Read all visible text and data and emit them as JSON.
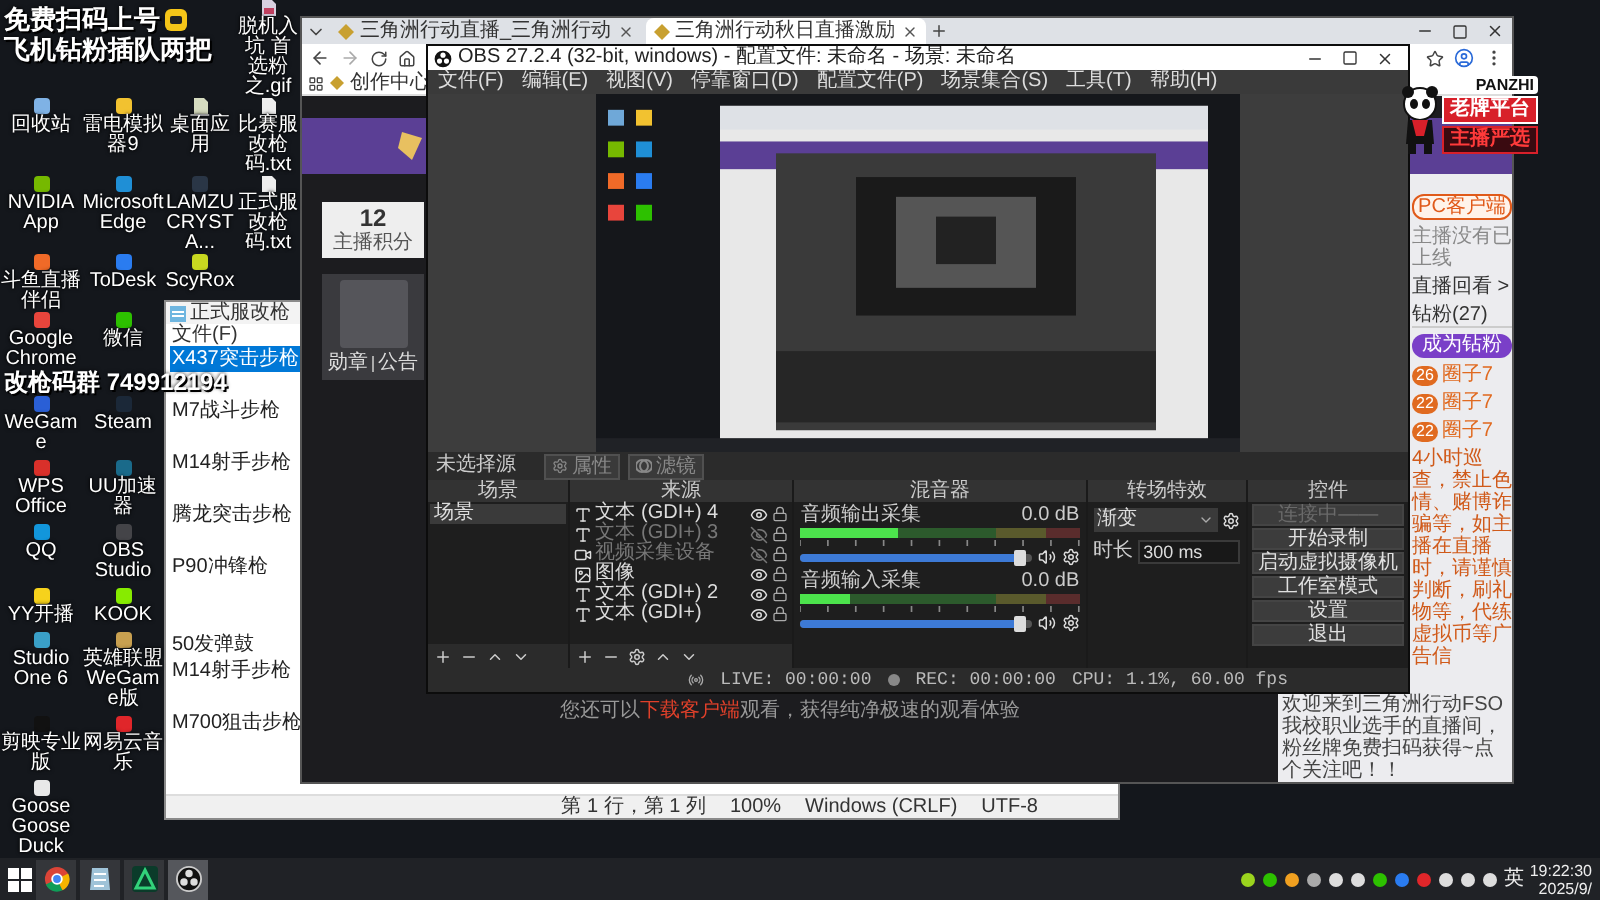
{
  "desktop": {
    "banner_lines": [
      "免费扫码上号",
      "飞机钻粉插队两把"
    ],
    "gif": {
      "label": "脱机入坑 首选粉之.gif",
      "kind": "image",
      "color": "#d8d0e0"
    },
    "icon_rows_top": [
      [
        {
          "label": "回收站",
          "kind": "app",
          "color": "#7fb2e5"
        },
        {
          "label": "雷电模拟器9",
          "kind": "app",
          "color": "#f2c230"
        },
        {
          "label": "桌面应用",
          "kind": "file",
          "color": "#d6dcc0"
        },
        {
          "label": "比赛服改枪码.txt",
          "kind": "file",
          "color": "#eeeeee"
        }
      ],
      [
        {
          "label": "NVIDIA App",
          "kind": "app",
          "color": "#76b900"
        },
        {
          "label": "Microsoft Edge",
          "kind": "app",
          "color": "#1f8fd6"
        },
        {
          "label": "LAMZU CRYSTA...",
          "kind": "app",
          "color": "#2a3646"
        },
        {
          "label": "正式服改枪码.txt",
          "kind": "file",
          "color": "#eeeeee"
        }
      ],
      [
        {
          "label": "斗鱼直播伴侣",
          "kind": "app",
          "color": "#f06a28"
        },
        {
          "label": "ToDesk",
          "kind": "app",
          "color": "#2a7cf0"
        },
        {
          "label": "ScyRox",
          "kind": "app",
          "color": "#c8d820"
        }
      ],
      [
        {
          "label": "Google Chrome",
          "kind": "app",
          "color": "#e8453c"
        },
        {
          "label": "微信",
          "kind": "app",
          "color": "#2dc100"
        }
      ]
    ],
    "overlay_text": "改枪码群 749912194",
    "icon_rows_bottom": [
      [
        {
          "label": "WeGame",
          "kind": "app",
          "color": "#2a5fd6"
        },
        {
          "label": "Steam",
          "kind": "app",
          "color": "#1b2838"
        }
      ],
      [
        {
          "label": "WPS Office",
          "kind": "app",
          "color": "#d9302a"
        },
        {
          "label": "UU加速器",
          "kind": "app",
          "color": "#1a6a8a"
        }
      ],
      [
        {
          "label": "QQ",
          "kind": "app",
          "color": "#1296db"
        },
        {
          "label": "OBS Studio",
          "kind": "app",
          "color": "#444448"
        }
      ],
      [
        {
          "label": "YY开播",
          "kind": "app",
          "color": "#f6d21c"
        },
        {
          "label": "KOOK",
          "kind": "app",
          "color": "#87eb00"
        }
      ],
      [
        {
          "label": "Studio One 6",
          "kind": "app",
          "color": "#3aa0c8"
        },
        {
          "label": "英雄联盟WeGame版",
          "kind": "app",
          "color": "#c8a050"
        }
      ],
      [
        {
          "label": "剪映专业版",
          "kind": "app",
          "color": "#111111"
        },
        {
          "label": "网易云音乐",
          "kind": "app",
          "color": "#e0262a"
        }
      ],
      [
        {
          "label": "Goose Goose Duck",
          "kind": "app",
          "color": "#e8e8e8"
        }
      ]
    ]
  },
  "notepad": {
    "title": "正式服改枪",
    "menu": [
      "文件(F)"
    ],
    "lines": [
      {
        "kind": "text",
        "text": "X437突击步枪",
        "selected": true
      },
      {
        "kind": "blank"
      },
      {
        "kind": "text",
        "text": "M7战斗步枪",
        "selected": false
      },
      {
        "kind": "blank"
      },
      {
        "kind": "text",
        "text": "M14射手步枪",
        "selected": false
      },
      {
        "kind": "blank"
      },
      {
        "kind": "text",
        "text": "腾龙突击步枪",
        "selected": false
      },
      {
        "kind": "blank"
      },
      {
        "kind": "text",
        "text": "P90冲锋枪",
        "selected": false
      },
      {
        "kind": "blank"
      },
      {
        "kind": "blank"
      },
      {
        "kind": "text",
        "text": "50发弹鼓",
        "selected": false
      },
      {
        "kind": "text",
        "text": "M14射手步枪",
        "selected": false
      },
      {
        "kind": "blank"
      },
      {
        "kind": "text",
        "text": "M700狙击步枪",
        "selected": false
      }
    ],
    "status": [
      "第 1 行，第 1 列",
      "100%",
      "Windows (CRLF)",
      "UTF-8"
    ]
  },
  "browser": {
    "tabs": [
      {
        "title": "三角洲行动直播_三角洲行动",
        "selected": false
      },
      {
        "title": "三角洲行动秋日直播激励",
        "selected": true
      }
    ],
    "bookmark": "创作中心",
    "left": {
      "score": "12",
      "score_label": "主播积分",
      "links": [
        "勋章",
        "公告"
      ]
    },
    "right": {
      "client_button": "PC客户端",
      "client_note": "主播没有已上线",
      "replay_link": "直播回看 >",
      "fan_tab": "钻粉(27)",
      "fan_badge": "成为钻粉",
      "fans": [
        {
          "level": "26",
          "name": "圈子7"
        },
        {
          "level": "22",
          "name": "圈子7"
        },
        {
          "level": "22",
          "name": "圈子7"
        }
      ],
      "rules": "4小时巡查，禁止色情、赌博诈骗等，如主播在直播时，请谨慎判断，刷礼物等，代练虚拟币等广告信"
    },
    "hint": [
      {
        "text": "您还可以",
        "kind": "text"
      },
      {
        "text": "下载客户端",
        "kind": "link"
      },
      {
        "text": "观看，获得纯净极速的观看体验",
        "kind": "text"
      }
    ],
    "message": "欢迎来到三角洲行动FSO我校职业选手的直播间，粉丝牌免费扫码获得~点个关注吧！！"
  },
  "sticker": {
    "brand": "PANZHI",
    "line1": "老牌平台",
    "line2": "主播严选"
  },
  "obs": {
    "title": "OBS 27.2.4 (32-bit, windows) - 配置文件: 未命名 - 场景: 未命名",
    "menu": [
      "文件(F)",
      "编辑(E)",
      "视图(V)",
      "停靠窗口(D)",
      "配置文件(P)",
      "场景集合(S)",
      "工具(T)",
      "帮助(H)"
    ],
    "selection": "未选择源",
    "selection_buttons": [
      "属性",
      "滤镜"
    ],
    "dock_titles": [
      "场景",
      "来源",
      "混音器",
      "转场特效",
      "控件"
    ],
    "scenes": [
      {
        "name": "场景",
        "selected": true
      }
    ],
    "sources": [
      {
        "name": "文本 (GDI+) 4",
        "kind": "text",
        "visible": true
      },
      {
        "name": "文本 (GDI+) 3",
        "kind": "text",
        "visible": false
      },
      {
        "name": "视频采集设备",
        "kind": "video",
        "visible": false
      },
      {
        "name": "图像",
        "kind": "image",
        "visible": true
      },
      {
        "name": "文本 (GDI+) 2",
        "kind": "text",
        "visible": true
      },
      {
        "name": "文本 (GDI+)",
        "kind": "text",
        "visible": true
      }
    ],
    "mixer": [
      {
        "name": "音频输出采集",
        "reading": "0.0 dB",
        "meter": {
          "level": 0.35
        },
        "fader": {
          "level": 0.95
        }
      },
      {
        "name": "音频输入采集",
        "reading": "0.0 dB",
        "meter": {
          "level": 0.18
        },
        "fader": {
          "level": 0.95
        }
      }
    ],
    "transition": {
      "name": "渐变",
      "duration_label": "时长",
      "duration": "300 ms"
    },
    "controls": [
      {
        "label": "连接中——",
        "disabled": true
      },
      {
        "label": "开始录制",
        "disabled": false
      },
      {
        "label": "启动虚拟摄像机",
        "disabled": false
      },
      {
        "label": "工作室模式",
        "disabled": false
      },
      {
        "label": "设置",
        "disabled": false
      },
      {
        "label": "退出",
        "disabled": false
      }
    ],
    "status": {
      "live": "LIVE: 00:00:00",
      "rec": "REC: 00:00:00",
      "cpu": "CPU: 1.1%, 60.00 fps"
    }
  },
  "taskbar": {
    "apps": [
      {
        "kind": "chrome",
        "active": false
      },
      {
        "kind": "notes",
        "active": false
      },
      {
        "kind": "green",
        "active": false
      },
      {
        "kind": "obs",
        "active": true
      }
    ],
    "ime": "英",
    "time": "19:22:30",
    "date": "2025/9/"
  }
}
